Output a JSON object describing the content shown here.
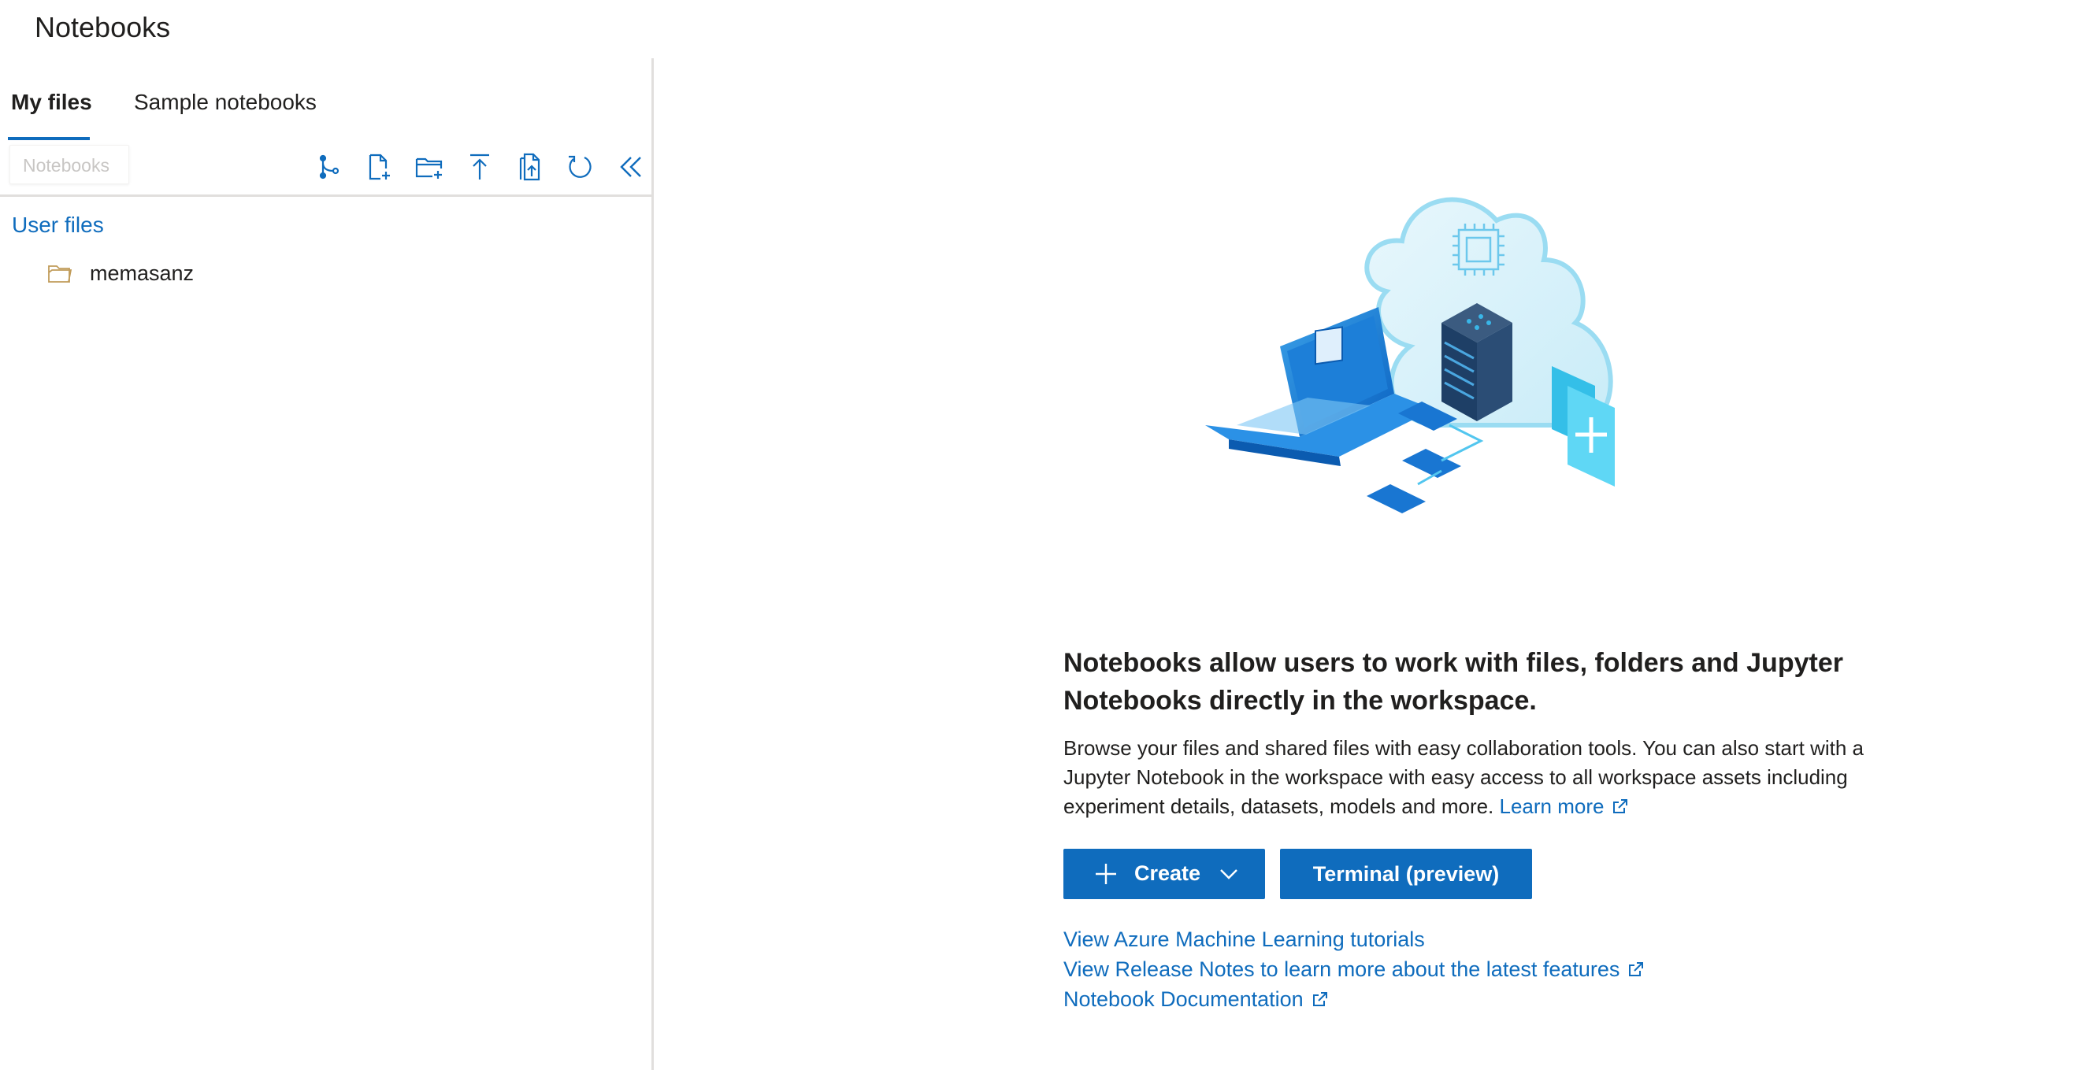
{
  "page": {
    "title": "Notebooks"
  },
  "sidebar": {
    "tabs": [
      {
        "label": "My files",
        "active": true
      },
      {
        "label": "Sample notebooks",
        "active": false
      }
    ],
    "search": {
      "placeholder": "Notebooks"
    },
    "toolbar": [
      {
        "icon": "git-branch-icon"
      },
      {
        "icon": "new-file-icon"
      },
      {
        "icon": "new-folder-icon"
      },
      {
        "icon": "upload-icon"
      },
      {
        "icon": "upload-folder-icon"
      },
      {
        "icon": "refresh-icon"
      },
      {
        "icon": "collapse-double-chevron-icon"
      }
    ],
    "tree": {
      "header": "User files",
      "items": [
        {
          "label": "memasanz",
          "icon": "folder-icon"
        }
      ]
    }
  },
  "main": {
    "headline": "Notebooks allow users to work with files, folders and Jupyter Notebooks directly in the workspace.",
    "description": "Browse your files and shared files with easy collaboration tools. You can also start with a Jupyter Notebook in the workspace with easy access to all workspace assets including experiment details, datasets, models and more.",
    "learn_more": "Learn more",
    "buttons": {
      "create": "Create",
      "terminal": "Terminal (preview)"
    },
    "links": [
      {
        "label": "View Azure Machine Learning tutorials",
        "external": false
      },
      {
        "label": "View Release Notes to learn more about the latest features",
        "external": true
      },
      {
        "label": "Notebook Documentation",
        "external": true
      }
    ]
  },
  "colors": {
    "accent": "#0f6cbd",
    "text": "#201f1e",
    "divider": "#e1dfdd",
    "folder": "#c19c5a"
  }
}
